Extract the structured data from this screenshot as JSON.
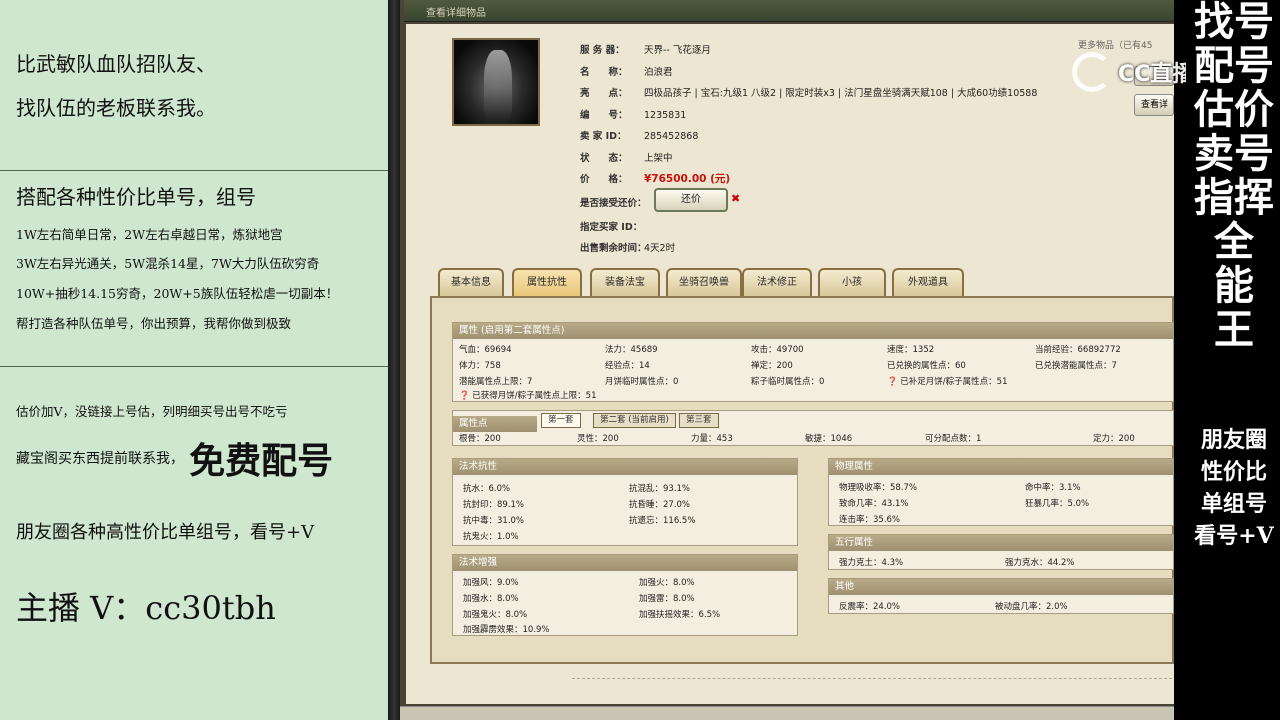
{
  "left_panel": {
    "line1": "比武敏队血队招队友、",
    "line2": "找队伍的老板联系我。",
    "heading": "搭配各种性价比单号，组号",
    "d1": "1W左右简单日常，2W左右卓越日常，炼狱地宫",
    "d2": "3W左右异光通关，5W混杀14星，7W大力队伍砍穷奇",
    "d3": "10W+抽秒14.15穷奇，20W+5族队伍轻松虐一切副本！",
    "d4": "帮打造各种队伍单号，你出预算，我帮你做到极致",
    "e1": "估价加V，没链接上号估，列明细买号出号不吃亏",
    "e2_small": "藏宝阁买东西提前联系我，",
    "e2_big": "免费配号",
    "e3": "朋友圈各种高性价比单组号，看号+V",
    "contact": "主播 V：cc30tbh"
  },
  "right_banner": {
    "slogan_lines": [
      "找号",
      "配号",
      "估价",
      "卖号",
      "指挥",
      "全",
      "能",
      "王"
    ],
    "sub_lines": [
      "朋友圈",
      "性价比",
      "单组号",
      "看号+V"
    ]
  },
  "watermark": {
    "text": "CC直播"
  },
  "game": {
    "window_title": "查看详细物品",
    "side_link": "更多物品（已有45",
    "side_button": "查看详",
    "info": [
      {
        "k": "服 务 器：",
        "v": "天界-- 飞花逐月"
      },
      {
        "k": "名　　称：",
        "v": "泊浪君"
      },
      {
        "k": "亮　　点：",
        "v": "四极品孩子 | 宝石:九级1 八级2 | 限定时装x3 | 法门星盘坐骑满天赋108 | 大成60功绩10588"
      },
      {
        "k": "编　　号：",
        "v": "1235831"
      },
      {
        "k": "卖 家 ID：",
        "v": "285452868"
      },
      {
        "k": "状　　态：",
        "v": "上架中"
      },
      {
        "k": "价　　格：",
        "v": "¥76500.00 (元)"
      }
    ],
    "counter_offer_label": "是否接受还价：",
    "counter_offer_button": "还价",
    "buyer_id_label": "指定买家 ID：",
    "remaining_label": "出售剩余时间：",
    "remaining_value": "4天2时",
    "tabs": [
      "基本信息",
      "属性抗性",
      "装备法宝",
      "坐骑召唤兽",
      "法术修正",
      "小孩",
      "外观道具"
    ],
    "attr_section": {
      "title": "属性 (启用第二套属性点)",
      "row1": [
        "气血：69694",
        "法力：45689",
        "攻击：49700",
        "速度：1352",
        "当前经验：66892772"
      ],
      "row2": [
        "体力：758",
        "经验点：14",
        "禅定：200",
        "已兑换的属性点：60",
        "已兑换潜能属性点：7"
      ],
      "row3": [
        "潜能属性点上限：7",
        "月饼临时属性点：0",
        "粽子临时属性点：0",
        "已补足月饼/粽子属性点：51"
      ],
      "row4": "已获得月饼/粽子属性点上限：51"
    },
    "points_section": {
      "title": "属性点",
      "subtabs": [
        "第一套",
        "第二套 (当前启用)",
        "第三套"
      ],
      "row": [
        "根骨：200",
        "灵性：200",
        "力量：453",
        "敏捷：1046",
        "可分配点数：1",
        "定力：200"
      ]
    },
    "resist_section": {
      "title": "法术抗性",
      "cells": [
        "抗水：6.0%",
        "抗混乱：93.1%",
        "抗封印：89.1%",
        "抗昏睡：27.0%",
        "抗中毒：31.0%",
        "抗遗忘：116.5%",
        "抗鬼火：1.0%"
      ]
    },
    "enhance_section": {
      "title": "法术增强",
      "cells": [
        "加强风：9.0%",
        "加强火：8.0%",
        "加强水：8.0%",
        "加强雷：8.0%",
        "加强鬼火：8.0%",
        "加强扶摇效果：6.5%",
        "加强霹雳效果：10.9%"
      ]
    },
    "phys_section": {
      "title": "物理属性",
      "cells": [
        "物理吸收率：58.7%",
        "命中率：3.1%",
        "致命几率：43.1%",
        "狂暴几率：5.0%",
        "连击率：35.6%"
      ]
    },
    "five_section": {
      "title": "五行属性",
      "cells": [
        "强力克土：4.3%",
        "强力克水：44.2%"
      ]
    },
    "other_section": {
      "title": "其他",
      "cells": [
        "反震率：24.0%",
        "被动盘几率：2.0%"
      ]
    }
  }
}
